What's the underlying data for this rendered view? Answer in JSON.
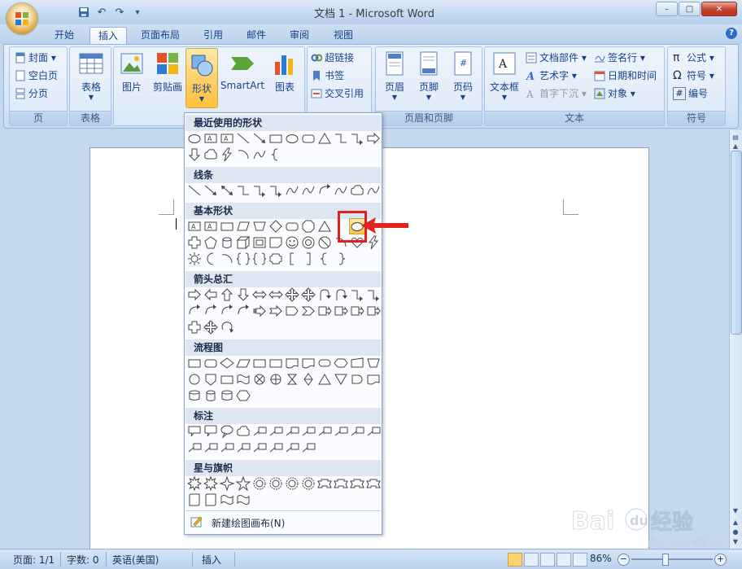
{
  "window": {
    "title": "文档 1 - Microsoft Word",
    "minimize": "–",
    "maximize": "□",
    "close": "✕"
  },
  "quick_access": {
    "save": "💾",
    "undo": "↶",
    "redo": "↷",
    "more": "▾"
  },
  "tabs": [
    {
      "label": "开始",
      "active": false
    },
    {
      "label": "插入",
      "active": true
    },
    {
      "label": "页面布局",
      "active": false
    },
    {
      "label": "引用",
      "active": false
    },
    {
      "label": "邮件",
      "active": false
    },
    {
      "label": "审阅",
      "active": false
    },
    {
      "label": "视图",
      "active": false
    }
  ],
  "help": "?",
  "ribbon": {
    "pages": {
      "label": "页",
      "cover": "封面 ▾",
      "blank": "空白页",
      "break": "分页"
    },
    "tables": {
      "label": "表格",
      "table": "表格"
    },
    "illustrations": {
      "picture": "图片",
      "clipart": "剪贴画",
      "shapes": "形状",
      "smartart": "SmartArt",
      "chart": "图表"
    },
    "links": {
      "hyperlink": "超链接",
      "bookmark": "书签",
      "crossref": "交叉引用"
    },
    "header_footer": {
      "label": "页眉和页脚",
      "header": "页眉",
      "footer": "页脚",
      "page_number": "页码"
    },
    "text": {
      "label": "文本",
      "textbox": "文本框",
      "quickparts": "文档部件 ▾",
      "wordart": "艺术字 ▾",
      "dropcap": "首字下沉 ▾",
      "signature": "签名行 ▾",
      "datetime": "日期和时间",
      "object": "对象 ▾"
    },
    "symbols": {
      "label": "符号",
      "equation": "公式 ▾",
      "symbol": "符号 ▾",
      "number": "编号"
    }
  },
  "gallery": {
    "sections": [
      "最近使用的形状",
      "线条",
      "基本形状",
      "箭头总汇",
      "流程图",
      "标注",
      "星与旗帜"
    ],
    "new_canvas": "新建绘图画布(N)"
  },
  "status": {
    "page": "页面: 1/1",
    "words": "字数: 0",
    "language": "英语(美国)",
    "mode": "插入",
    "zoom": "86%"
  },
  "watermark": {
    "brand": "Baidu经验",
    "url": "jingyan.baidu.com"
  },
  "colors": {
    "accent": "#15428b",
    "highlight": "#e21f1f",
    "ribbon_bg": "#dde9f8"
  }
}
